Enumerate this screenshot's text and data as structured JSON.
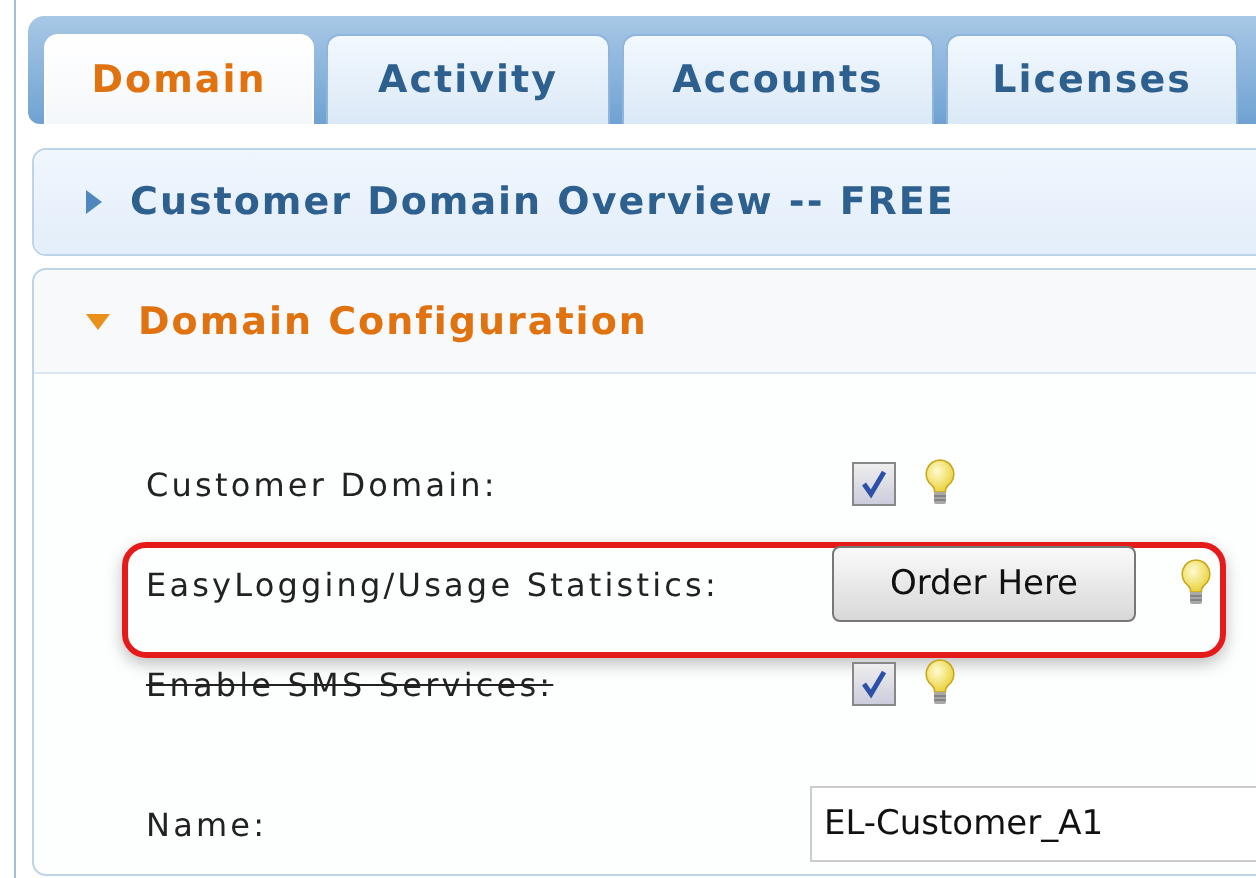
{
  "tabs": [
    {
      "label": "Domain",
      "selected": true
    },
    {
      "label": "Activity",
      "selected": false
    },
    {
      "label": "Accounts",
      "selected": false
    },
    {
      "label": "Licenses",
      "selected": false
    }
  ],
  "sections": [
    {
      "title": "Customer Domain Overview -- FREE",
      "expanded": false
    },
    {
      "title": "Domain Configuration",
      "expanded": true
    }
  ],
  "fields": [
    {
      "kind": "checkbox",
      "label": "Customer Domain:",
      "checked": true,
      "struck": false,
      "highlighted": false
    },
    {
      "kind": "button",
      "label": "EasyLogging/Usage Statistics:",
      "button": "Order Here",
      "struck": false,
      "highlighted": true
    },
    {
      "kind": "checkbox",
      "label": "Enable SMS Services:",
      "checked": true,
      "struck": true,
      "highlighted": false
    },
    {
      "kind": "text",
      "label": "Name:",
      "value": "EL-Customer_A1",
      "struck": false,
      "highlighted": false
    }
  ]
}
